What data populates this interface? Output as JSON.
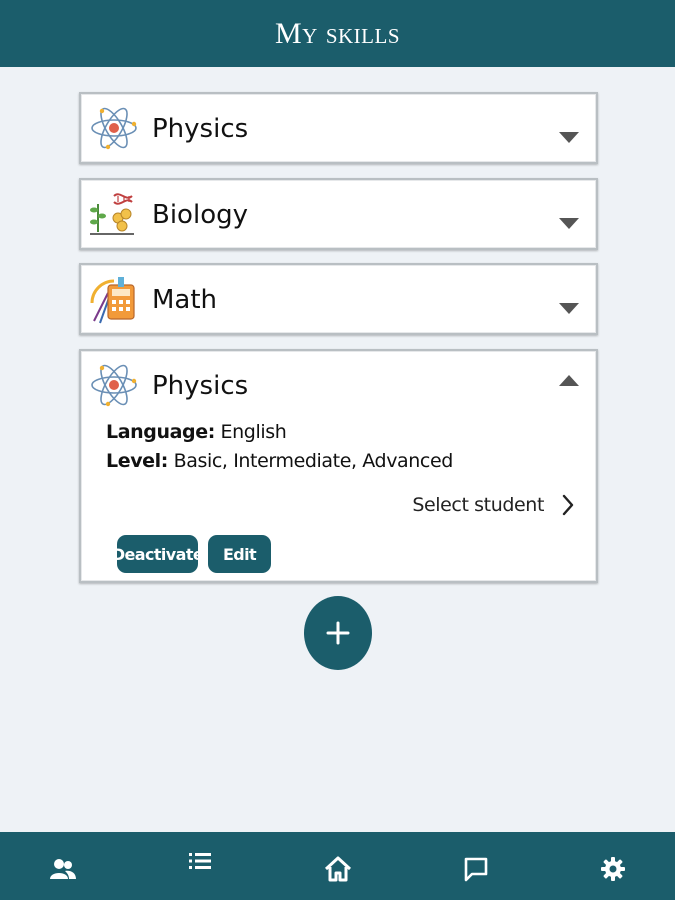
{
  "header": {
    "title": "My skills"
  },
  "skills": [
    {
      "name": "Physics",
      "icon": "atom-icon",
      "expanded": false
    },
    {
      "name": "Biology",
      "icon": "dna-plant-icon",
      "expanded": false
    },
    {
      "name": "Math",
      "icon": "calculator-compass-icon",
      "expanded": false
    },
    {
      "name": "Physics",
      "icon": "atom-icon",
      "expanded": true,
      "language_label": "Language:",
      "language_value": "English",
      "level_label": "Level:",
      "level_value": "Basic, Intermediate, Advanced",
      "select_student_label": "Select student",
      "deactivate_label": "Deactivate",
      "edit_label": "Edit"
    }
  ],
  "fab": {
    "icon": "plus-icon"
  },
  "bottom_nav": {
    "items": [
      {
        "icon": "users-icon"
      },
      {
        "icon": "list-icon"
      },
      {
        "icon": "home-icon"
      },
      {
        "icon": "chat-icon"
      },
      {
        "icon": "gear-icon"
      }
    ]
  },
  "colors": {
    "primary": "#1b5d6b",
    "background": "#eef2f6",
    "card": "#ffffff"
  }
}
